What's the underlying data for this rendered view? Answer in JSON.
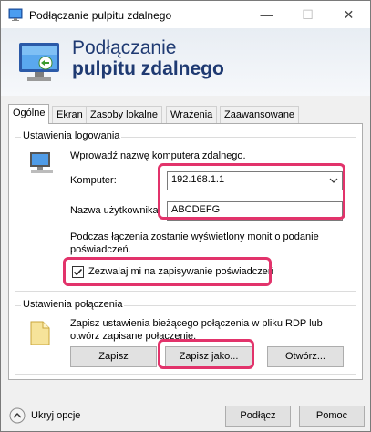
{
  "window": {
    "title": "Podłączanie pulpitu zdalnego",
    "controls": {
      "minimize": "—",
      "maximize": "☐",
      "close": "✕"
    }
  },
  "header": {
    "title_line1": "Podłączanie",
    "title_line2": "pulpitu zdalnego"
  },
  "tabs": [
    {
      "label": "Ogólne",
      "active": true
    },
    {
      "label": "Ekran",
      "active": false
    },
    {
      "label": "Zasoby lokalne",
      "active": false
    },
    {
      "label": "Wrażenia",
      "active": false
    },
    {
      "label": "Zaawansowane",
      "active": false
    }
  ],
  "logon": {
    "group_label": "Ustawienia logowania",
    "instruction": "Wprowadź nazwę komputera zdalnego.",
    "computer_label": "Komputer:",
    "computer_value": "192.168.1.1",
    "username_label": "Nazwa użytkownika:",
    "username_value": "ABCDEFG",
    "prompt_note_line1": "Podczas łączenia zostanie wyświetlony monit o podanie",
    "prompt_note_line2": "poświadczeń.",
    "save_credentials_label": "Zezwalaj mi na zapisywanie poświadczeń",
    "save_credentials_checked": true
  },
  "connection": {
    "group_label": "Ustawienia połączenia",
    "description_line1": "Zapisz ustawienia bieżącego połączenia w pliku RDP lub",
    "description_line2": "otwórz zapisane połączenie.",
    "save_button": "Zapisz",
    "save_as_button": "Zapisz jako...",
    "open_button": "Otwórz..."
  },
  "footer": {
    "hide_options": "Ukryj opcje",
    "connect_button": "Podłącz",
    "help_button": "Pomoc"
  },
  "colors": {
    "highlight": "#e2336b",
    "header_title": "#1f3a72"
  }
}
